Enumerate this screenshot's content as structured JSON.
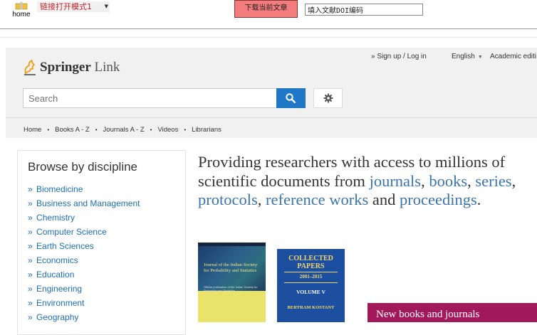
{
  "toolbar": {
    "home_label": "home",
    "mode_select": "链接打开模式1",
    "download_label": "下载当前文章",
    "doi_value": "填入文献DOI编码"
  },
  "header": {
    "logo_primary": "Springer",
    "logo_secondary": "Link",
    "signin": "» Sign up / Log in",
    "language": "English",
    "academic": "Academic editi",
    "search_placeholder": "Search",
    "nav": [
      "Home",
      "Books A - Z",
      "Journals A - Z",
      "Videos",
      "Librarians"
    ]
  },
  "browse": {
    "title": "Browse by discipline",
    "items": [
      "Biomedicine",
      "Business and Management",
      "Chemistry",
      "Computer Science",
      "Earth Sciences",
      "Economics",
      "Education",
      "Engineering",
      "Environment",
      "Geography"
    ]
  },
  "hero": {
    "t1": "Providing researchers with access to millions of scientific documents from ",
    "journals": "journals",
    "c1": ", ",
    "books": "books",
    "c2": ", ",
    "series": "series",
    "c3": ", ",
    "protocols": "protocols",
    "c4": ", ",
    "reference": "reference works",
    "and": " and ",
    "proceedings": "proceedings",
    "end": "."
  },
  "covers": {
    "c1_title": "Journal of the Indian Society for Probability and Statistics",
    "c1_sub": "Official publication of the Indian Society for Probability and Statistics",
    "c2_title": "COLLECTED PAPERS",
    "c2_years": "2001–2015",
    "c2_volume": "VOLUME V",
    "c2_author": "BERTRAM KOSTANT"
  },
  "promo": {
    "text": "New books and journals"
  },
  "colors": {
    "accent": "#1f77c5",
    "link": "#1f6eb4",
    "promo": "#a2195b",
    "download": "#f47c7c"
  }
}
